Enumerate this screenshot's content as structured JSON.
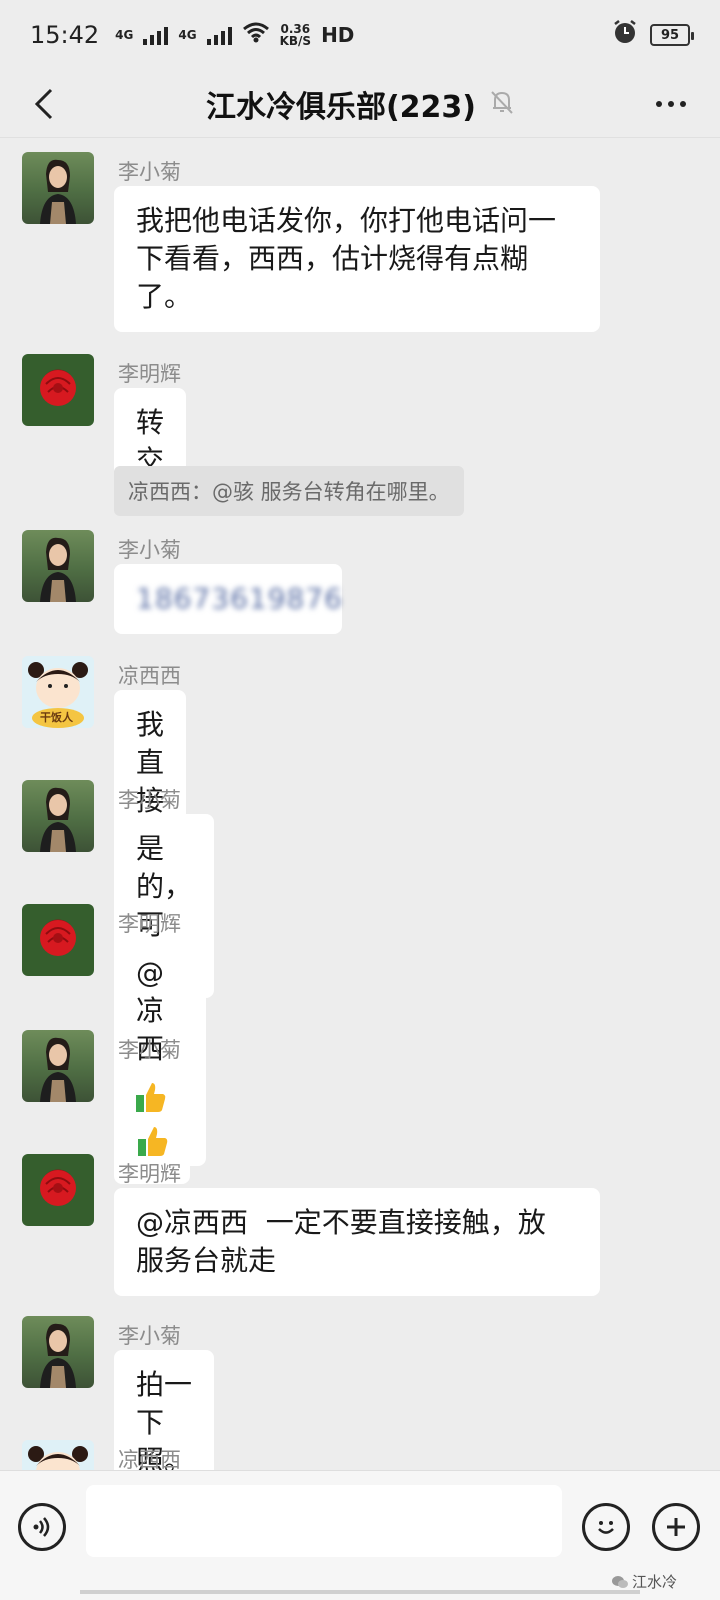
{
  "status_bar": {
    "time": "15:42",
    "net1": "4G",
    "net2": "4G",
    "speed_value": "0.36",
    "speed_unit": "KB/S",
    "hd": "HD",
    "battery": "95"
  },
  "header": {
    "title": "江水冷俱乐部(223)"
  },
  "messages": [
    {
      "sender": "李小菊",
      "text_lines": [
        "我把他电话发你，你打他电话问一",
        "下看看，西西，估计烧得有点糊",
        "了。"
      ]
    },
    {
      "sender": "李明辉",
      "text": "转交",
      "quote": "凉西西：@骇 服务台转角在哪里。"
    },
    {
      "sender": "李小菊",
      "text": "18673619876"
    },
    {
      "sender": "凉西西",
      "text": "我直接给他打电话吧"
    },
    {
      "sender": "李小菊",
      "text": "是的，可以。"
    },
    {
      "sender": "李明辉",
      "text": "@凉西西"
    },
    {
      "sender": "李小菊"
    },
    {
      "sender": "李明辉",
      "text_lines": [
        "@凉西西  一定不要直接接触，放",
        "服务台就走"
      ]
    },
    {
      "sender": "李小菊",
      "text": "拍一下照。"
    },
    {
      "sender": "凉西西"
    }
  ],
  "avatar_labels": {
    "cartoon": "干饭人"
  },
  "watermark": {
    "brand": "江水冷"
  },
  "colors": {
    "background": "#ededed",
    "bubble": "#ffffff",
    "sender": "#8c8c8c",
    "quote_bg": "#e0e0e0"
  }
}
